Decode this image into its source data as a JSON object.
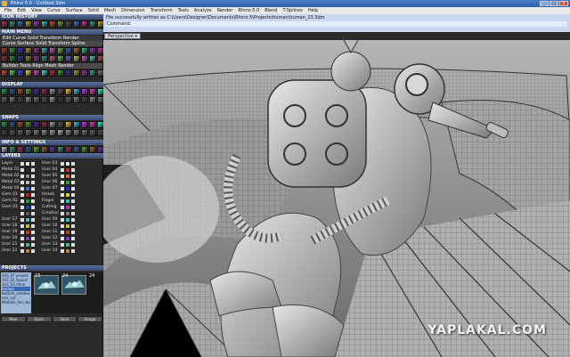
{
  "window": {
    "title": "Rhino 5.0 - Untitled.3dm",
    "controls": {
      "minimize": "_",
      "maximize": "□",
      "close": "x"
    }
  },
  "menubar": [
    "File",
    "Edit",
    "View",
    "Curve",
    "Surface",
    "Solid",
    "Mesh",
    "Dimension",
    "Transform",
    "Tools",
    "Analyze",
    "Render",
    "Rhino 5.0",
    "Blend",
    "T-Splines",
    "Help"
  ],
  "sidebar": {
    "icon_history": "ICON HISTORY",
    "main_menu": "MAIN MENU",
    "main_tabs": "Edit Curve Solid Transform Render",
    "main_rows": [
      "Curve  Surface  Solid  Transform  Spline",
      "Builder  Tools  Align  Mesh  Render"
    ],
    "display": "DISPLAY",
    "snaps": "SNAPS",
    "info": "INFO & SETTINGS",
    "layers": "LAYERS",
    "projects": "PROJECTS"
  },
  "layers": {
    "left": [
      {
        "name": "Layer",
        "color": "#e8e8e8"
      },
      {
        "name": "Metal 01",
        "color": "#2a2a2a"
      },
      {
        "name": "Metal 02",
        "color": "#8a8a8a"
      },
      {
        "name": "Metal 03",
        "color": "#b8b8b8"
      },
      {
        "name": "Metal 04",
        "color": "#3a6fd0"
      },
      {
        "name": "Gem 01",
        "color": "#c02020"
      },
      {
        "name": "Gem 02",
        "color": "#20a040"
      },
      {
        "name": "Gem 03",
        "color": "#2040c0"
      },
      {
        "name": "",
        "color": "#5a5a5a"
      },
      {
        "name": "User 17",
        "color": "#3ac0c0"
      },
      {
        "name": "User 18",
        "color": "#c0c020"
      },
      {
        "name": "User 19",
        "color": "#c04020"
      },
      {
        "name": "User 20",
        "color": "#8040c0"
      },
      {
        "name": "User 21",
        "color": "#40c080"
      },
      {
        "name": "User 22",
        "color": "#c08040"
      }
    ],
    "right": [
      {
        "name": "User 03",
        "color": "#e8e8e8"
      },
      {
        "name": "User 04",
        "color": "#d03030"
      },
      {
        "name": "User 05",
        "color": "#d07030"
      },
      {
        "name": "User 06",
        "color": "#30a030"
      },
      {
        "name": "User 07",
        "color": "#3030d0"
      },
      {
        "name": "Heads",
        "color": "#d0d030"
      },
      {
        "name": "Finger",
        "color": "#30c0c0"
      },
      {
        "name": "Cutting",
        "color": "#c030c0"
      },
      {
        "name": "Creation",
        "color": "#808080"
      },
      {
        "name": "User 09",
        "color": "#30c0c0"
      },
      {
        "name": "User 10",
        "color": "#c0c030"
      },
      {
        "name": "User 11",
        "color": "#c04030"
      },
      {
        "name": "User 12",
        "color": "#8040c0"
      },
      {
        "name": "User 13",
        "color": "#40c080"
      },
      {
        "name": "User 14",
        "color": "#c08040"
      }
    ]
  },
  "projects": {
    "items": [
      "343_07 project",
      "343_01 layout",
      "343_03 rhino",
      "human",
      "bottom_window",
      "neo_cut",
      "Medaila_fon_wo"
    ],
    "selected": 3,
    "thumbs": [
      "23",
      "24",
      "24"
    ],
    "buttons": [
      "New",
      "Open",
      "Save",
      "Image"
    ]
  },
  "command": {
    "line1": "File successfully written as C:\\Users\\Designer\\Documents\\Rhino 5\\Projects\\human\\human_23.3dm",
    "line2": "Command:"
  },
  "viewport": {
    "label": "Perspective ▾"
  },
  "watermark": "YAPLAKAL.COM"
}
